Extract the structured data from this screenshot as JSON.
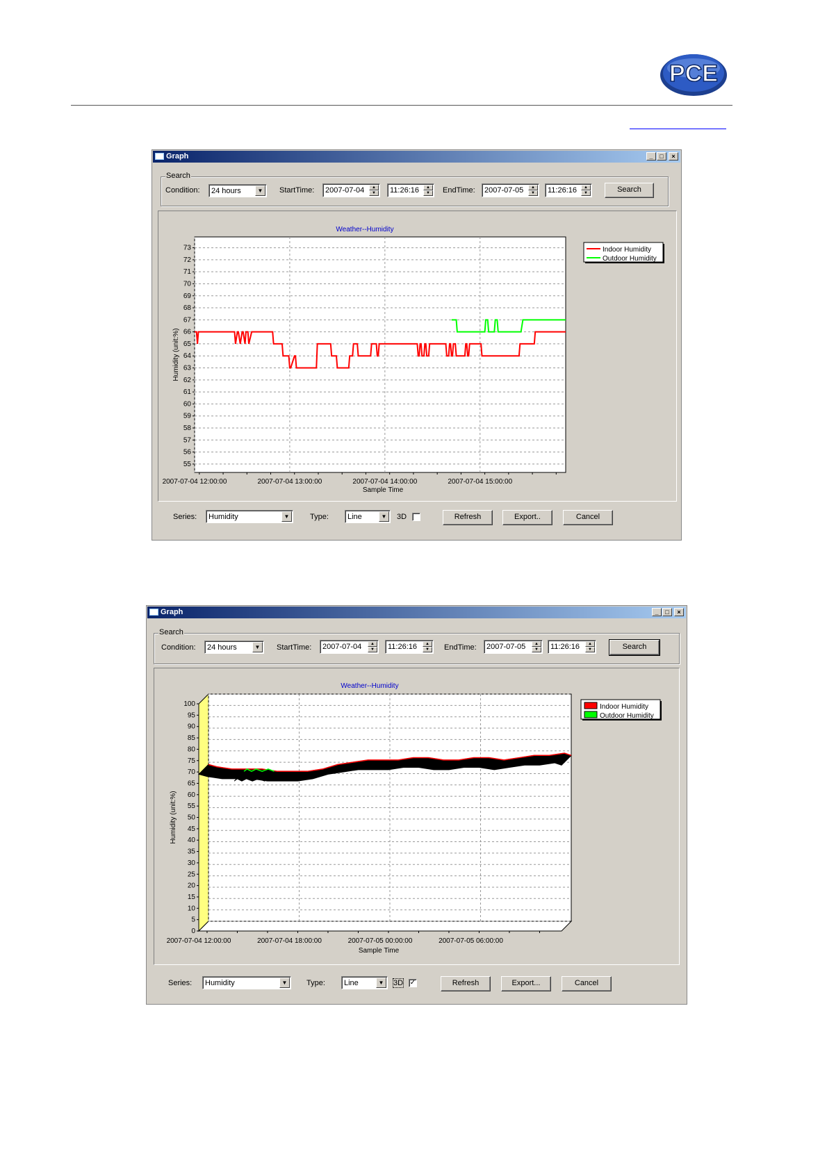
{
  "page": {
    "brand": "PCE"
  },
  "windows": [
    {
      "title": "Graph",
      "search_group": "Search",
      "condition_label": "Condition:",
      "condition_value": "24 hours",
      "start_label": "StartTime:",
      "start_date": "2007-07-04",
      "start_time": "11:26:16",
      "end_label": "EndTime:",
      "end_date": "2007-07-05",
      "end_time": "11:26:16",
      "search_button": "Search",
      "series_label": "Series:",
      "series_value": "Humidity",
      "type_label": "Type:",
      "type_value": "Line",
      "threed_label": "3D",
      "threed_checked": false,
      "refresh_button": "Refresh",
      "export_button": "Export..",
      "cancel_button": "Cancel"
    },
    {
      "title": "Graph",
      "search_group": "Search",
      "condition_label": "Condition:",
      "condition_value": "24 hours",
      "start_label": "StartTime:",
      "start_date": "2007-07-04",
      "start_time": "11:26:16",
      "end_label": "EndTime:",
      "end_date": "2007-07-05",
      "end_time": "11:26:16",
      "search_button": "Search",
      "series_label": "Series:",
      "series_value": "Humidity",
      "type_label": "Type:",
      "type_value": "Line",
      "threed_label": "3D",
      "threed_checked": true,
      "refresh_button": "Refresh",
      "export_button": "Export...",
      "cancel_button": "Cancel"
    }
  ],
  "chart_data": [
    {
      "type": "line",
      "title": "Weather--Humidity",
      "xlabel": "Sample Time",
      "ylabel": "Humidity (unit:%)",
      "ylim": [
        54.3,
        73.9
      ],
      "yticks": [
        73,
        72,
        71,
        70,
        69,
        68,
        67,
        66,
        65,
        64,
        63,
        62,
        61,
        60,
        59,
        58,
        57,
        56,
        55
      ],
      "xticks": [
        "2007-07-04 12:00:00",
        "2007-07-04 13:00:00",
        "2007-07-04 14:00:00",
        "2007-07-04 15:00:00"
      ],
      "xrange_hours": [
        11.45,
        15.35
      ],
      "grid": true,
      "legend": "top-right",
      "series": [
        {
          "name": "Indoor Humidity",
          "color": "#ff0000",
          "x": [
            11.45,
            11.47,
            11.48,
            11.49,
            11.87,
            11.88,
            11.9,
            11.91,
            11.93,
            11.95,
            11.96,
            11.98,
            11.99,
            12.01,
            12.02,
            12.05,
            12.07,
            12.08,
            12.09,
            12.27,
            12.28,
            12.37,
            12.38,
            12.44,
            12.45,
            12.46,
            12.5,
            12.51,
            12.52,
            12.73,
            12.74,
            12.88,
            12.89,
            12.94,
            12.95,
            13.07,
            13.08,
            13.11,
            13.12,
            13.16,
            13.17,
            13.3,
            13.31,
            13.36,
            13.37,
            13.38,
            13.39,
            13.79,
            13.8,
            13.81,
            13.82,
            13.83,
            13.84,
            13.86,
            13.87,
            13.88,
            13.89,
            13.91,
            13.92,
            14.09,
            14.1,
            14.12,
            14.13,
            14.14,
            14.15,
            14.16,
            14.17,
            14.19,
            14.2,
            14.29,
            14.3,
            14.31,
            14.32,
            14.33,
            14.34,
            14.46,
            14.47,
            14.86,
            14.87,
            15.02,
            15.03,
            15.35
          ],
          "y": [
            66,
            66,
            65,
            66,
            66,
            65,
            66,
            66,
            65,
            66,
            66,
            65,
            66,
            66,
            65,
            66,
            66,
            66,
            66,
            66,
            65,
            65,
            64,
            64,
            63,
            63,
            64,
            64,
            63,
            63,
            65,
            65,
            64,
            64,
            63,
            63,
            64,
            64,
            65,
            65,
            64,
            64,
            65,
            65,
            64,
            64,
            65,
            65,
            64,
            64,
            65,
            65,
            64,
            64,
            65,
            65,
            64,
            64,
            65,
            65,
            64,
            64,
            65,
            65,
            64,
            64,
            65,
            65,
            64,
            64,
            65,
            65,
            64,
            64,
            65,
            65,
            64,
            64,
            65,
            65,
            66,
            66
          ]
        },
        {
          "name": "Outdoor Humidity",
          "color": "#00ff00",
          "x": [
            14.15,
            14.2,
            14.21,
            14.25,
            14.26,
            14.5,
            14.51,
            14.53,
            14.54,
            14.6,
            14.61,
            14.63,
            14.64,
            14.88,
            14.9,
            15.35
          ],
          "y": [
            67,
            67,
            66,
            66,
            66,
            66,
            67,
            67,
            66,
            66,
            67,
            67,
            66,
            66,
            67,
            67
          ]
        }
      ]
    },
    {
      "type": "line",
      "title": "Weather--Humidity",
      "xlabel": "Sample Time",
      "ylabel": "Humidity (unit:%)",
      "ylim": [
        0,
        100
      ],
      "yticks": [
        100,
        95,
        90,
        85,
        80,
        75,
        70,
        65,
        60,
        55,
        50,
        45,
        40,
        35,
        30,
        25,
        20,
        15,
        10,
        5,
        0
      ],
      "xticks": [
        "2007-07-04 12:00:00",
        "2007-07-04 18:00:00",
        "2007-07-05 00:00:00",
        "2007-07-05 06:00:00"
      ],
      "xrange_hours": [
        11.45,
        35.45
      ],
      "three_d": true,
      "grid": true,
      "legend": "top-right",
      "series": [
        {
          "name": "Indoor Humidity",
          "color": "#ff0000",
          "x": [
            11.45,
            12,
            13,
            14,
            15,
            16,
            17,
            18,
            19,
            20,
            21,
            22,
            23,
            24,
            25,
            26,
            27,
            28,
            29,
            30,
            31,
            32,
            33,
            34,
            35,
            35.45
          ],
          "y": [
            69,
            68,
            67,
            67,
            67,
            66,
            66,
            66,
            67,
            69,
            70,
            71,
            71,
            71,
            72,
            72,
            71,
            71,
            72,
            72,
            71,
            72,
            73,
            73,
            74,
            73
          ]
        },
        {
          "name": "Outdoor Humidity",
          "color": "#00ff00",
          "x": [
            13.8,
            14,
            14.3,
            14.6,
            15,
            15.4,
            15.8
          ],
          "y": [
            66,
            67,
            66,
            67,
            66,
            67,
            66
          ]
        }
      ]
    }
  ]
}
